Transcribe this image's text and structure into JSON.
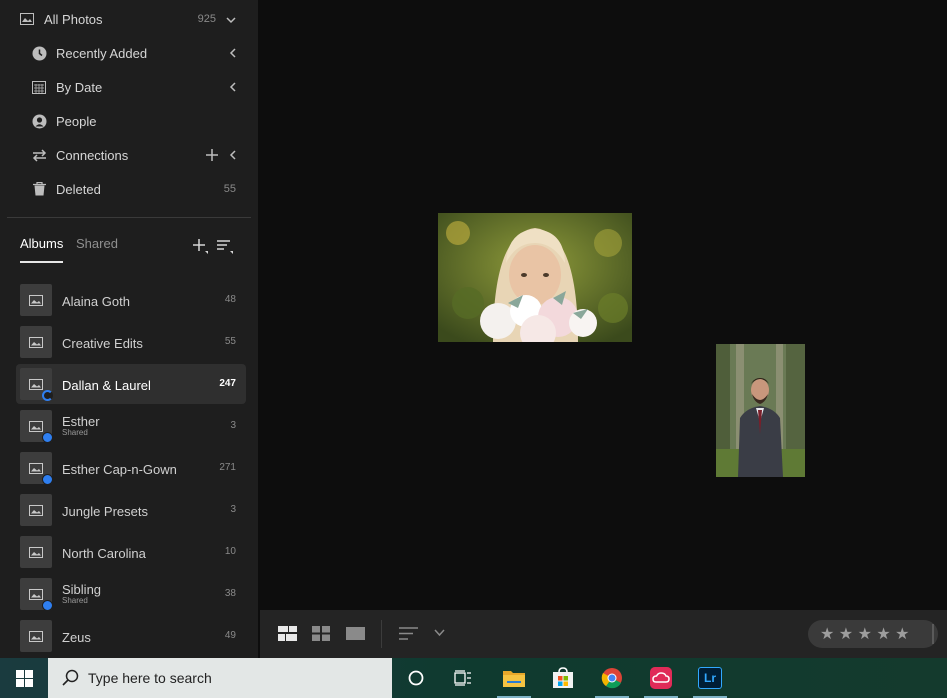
{
  "sidebar": {
    "nav": [
      {
        "label": "All Photos",
        "count": "925",
        "icon": "photos-icon"
      },
      {
        "label": "Recently Added",
        "icon": "clock-icon"
      },
      {
        "label": "By Date",
        "icon": "calendar-icon"
      },
      {
        "label": "People",
        "icon": "person-icon"
      },
      {
        "label": "Connections",
        "icon": "arrows-icon"
      },
      {
        "label": "Deleted",
        "count": "55",
        "icon": "trash-icon"
      }
    ],
    "tabs": {
      "albums": "Albums",
      "shared": "Shared"
    },
    "albums": [
      {
        "name": "Alaina Goth",
        "count": "48"
      },
      {
        "name": "Creative Edits",
        "count": "55"
      },
      {
        "name": "Dallan & Laurel",
        "count": "247"
      },
      {
        "name": "Esther",
        "sub": "Shared",
        "count": "3"
      },
      {
        "name": "Esther Cap-n-Gown",
        "count": "271"
      },
      {
        "name": "Jungle Presets",
        "count": "3"
      },
      {
        "name": "North Carolina",
        "count": "10"
      },
      {
        "name": "Sibling",
        "sub": "Shared",
        "count": "38"
      },
      {
        "name": "Zeus",
        "count": "49"
      }
    ]
  },
  "rating": {
    "stars": "★ ★ ★ ★ ★",
    "value": 0
  },
  "taskbar": {
    "search_placeholder": "Type here to search",
    "lr_label": "Lr"
  },
  "colors": {
    "accent": "#2f7ff0",
    "sidebar_bg": "#1e1e1e",
    "main_bg": "#0d0d0d"
  }
}
